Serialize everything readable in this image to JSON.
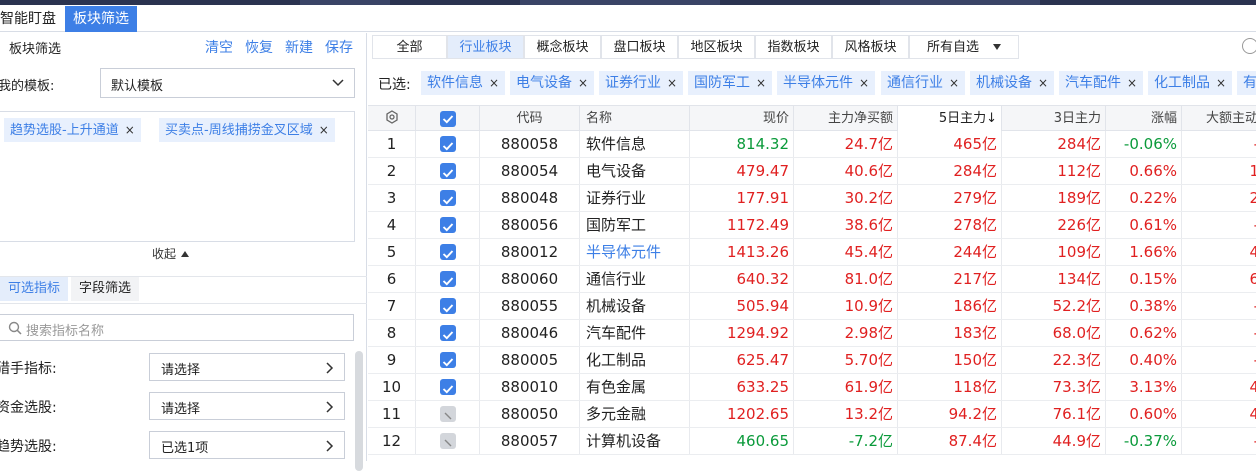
{
  "tabs": [
    {
      "label": "智能盯盘",
      "active": false
    },
    {
      "label": "板块筛选",
      "active": true
    }
  ],
  "left": {
    "title": "板块筛选",
    "actions": [
      "清空",
      "恢复",
      "新建",
      "保存"
    ],
    "template_label": "我的模板:",
    "template_value": "默认模板",
    "tags": [
      "趋势选股-上升通道",
      "买卖点-周线捕捞金叉区域"
    ],
    "collapse_label": "收起",
    "subtabs": [
      {
        "label": "可选指标",
        "active": true
      },
      {
        "label": "字段筛选",
        "active": false
      }
    ],
    "search_placeholder": "搜索指标名称",
    "filters": [
      {
        "label": "猎手指标:",
        "value": "请选择"
      },
      {
        "label": "资金选股:",
        "value": "请选择"
      },
      {
        "label": "趋势选股:",
        "value": "已选1项"
      }
    ]
  },
  "category_tabs": [
    {
      "label": "全部",
      "active": false
    },
    {
      "label": "行业板块",
      "active": true
    },
    {
      "label": "概念板块",
      "active": false
    },
    {
      "label": "盘口板块",
      "active": false
    },
    {
      "label": "地区板块",
      "active": false
    },
    {
      "label": "指数板块",
      "active": false
    },
    {
      "label": "风格板块",
      "active": false
    },
    {
      "label": "所有自选",
      "active": false
    }
  ],
  "selected_label": "已选:",
  "selected_chips": [
    "软件信息",
    "电气设备",
    "证券行业",
    "国防军工",
    "半导体元件",
    "通信行业",
    "机械设备",
    "汽车配件",
    "化工制品",
    "有"
  ],
  "columns": [
    "",
    "",
    "代码",
    "名称",
    "现价",
    "主力净买额",
    "5日主力↓",
    "3日主力",
    "涨幅",
    "大额主动"
  ],
  "rows": [
    {
      "idx": "1",
      "checked": true,
      "code": "880058",
      "name": "软件信息",
      "price": "814.32",
      "net": "24.7亿",
      "d5": "465亿",
      "d3": "284亿",
      "chg": "-0.06%",
      "big": "-",
      "dir": "down"
    },
    {
      "idx": "2",
      "checked": true,
      "code": "880054",
      "name": "电气设备",
      "price": "479.47",
      "net": "40.6亿",
      "d5": "284亿",
      "d3": "112亿",
      "chg": "0.66%",
      "big": "1",
      "dir": "up"
    },
    {
      "idx": "3",
      "checked": true,
      "code": "880048",
      "name": "证券行业",
      "price": "177.91",
      "net": "30.2亿",
      "d5": "279亿",
      "d3": "189亿",
      "chg": "0.22%",
      "big": "2",
      "dir": "up"
    },
    {
      "idx": "4",
      "checked": true,
      "code": "880056",
      "name": "国防军工",
      "price": "1172.49",
      "net": "38.6亿",
      "d5": "278亿",
      "d3": "226亿",
      "chg": "0.61%",
      "big": "-",
      "dir": "up"
    },
    {
      "idx": "5",
      "checked": true,
      "code": "880012",
      "name": "半导体元件",
      "price": "1413.26",
      "net": "45.4亿",
      "d5": "244亿",
      "d3": "109亿",
      "chg": "1.66%",
      "big": "4",
      "dir": "up",
      "highlight": true
    },
    {
      "idx": "6",
      "checked": true,
      "code": "880060",
      "name": "通信行业",
      "price": "640.32",
      "net": "81.0亿",
      "d5": "217亿",
      "d3": "134亿",
      "chg": "0.15%",
      "big": "6",
      "dir": "up"
    },
    {
      "idx": "7",
      "checked": true,
      "code": "880055",
      "name": "机械设备",
      "price": "505.94",
      "net": "10.9亿",
      "d5": "186亿",
      "d3": "52.2亿",
      "chg": "0.38%",
      "big": "-",
      "dir": "up"
    },
    {
      "idx": "8",
      "checked": true,
      "code": "880046",
      "name": "汽车配件",
      "price": "1294.92",
      "net": "2.98亿",
      "d5": "183亿",
      "d3": "68.0亿",
      "chg": "0.62%",
      "big": "-",
      "dir": "up"
    },
    {
      "idx": "9",
      "checked": true,
      "code": "880005",
      "name": "化工制品",
      "price": "625.47",
      "net": "5.70亿",
      "d5": "150亿",
      "d3": "22.3亿",
      "chg": "0.40%",
      "big": "-",
      "dir": "up"
    },
    {
      "idx": "10",
      "checked": true,
      "code": "880010",
      "name": "有色金属",
      "price": "633.25",
      "net": "61.9亿",
      "d5": "118亿",
      "d3": "73.3亿",
      "chg": "3.13%",
      "big": "4",
      "dir": "up"
    },
    {
      "idx": "11",
      "checked": false,
      "code": "880050",
      "name": "多元金融",
      "price": "1202.65",
      "net": "13.2亿",
      "d5": "94.2亿",
      "d3": "76.1亿",
      "chg": "0.60%",
      "big": "4",
      "dir": "up"
    },
    {
      "idx": "12",
      "checked": false,
      "code": "880057",
      "name": "计算机设备",
      "price": "460.65",
      "net": "-7.2亿",
      "d5": "87.4亿",
      "d3": "44.9亿",
      "chg": "-0.37%",
      "big": "-",
      "dir": "down"
    }
  ],
  "colors": {
    "accent": "#3d7fe6",
    "up": "#e02020",
    "down": "#0a9a3a"
  }
}
